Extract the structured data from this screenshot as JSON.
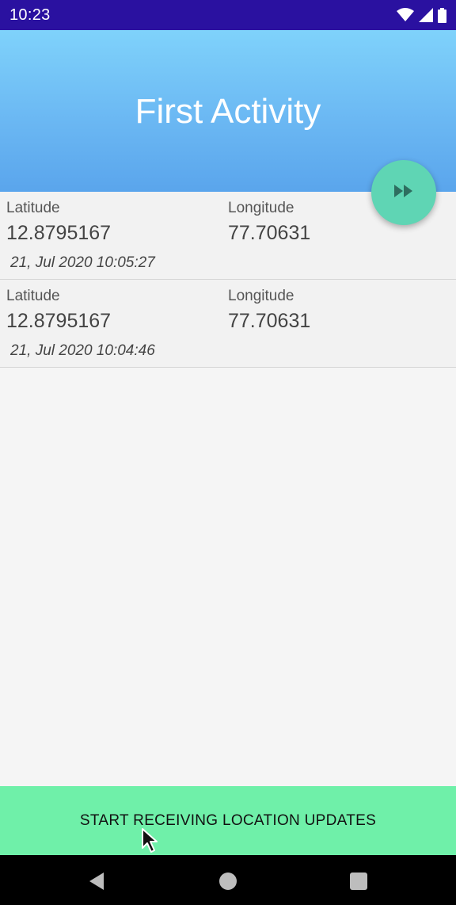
{
  "status_bar": {
    "time": "10:23",
    "icons": [
      "wifi-icon",
      "cellular-signal-icon",
      "battery-icon"
    ]
  },
  "header": {
    "title": "First Activity"
  },
  "fab": {
    "icon": "fast-forward-icon"
  },
  "locations": [
    {
      "latitude_label": "Latitude",
      "latitude": "12.8795167",
      "longitude_label": "Longitude",
      "longitude": "77.70631",
      "timestamp": "21, Jul 2020 10:05:27"
    },
    {
      "latitude_label": "Latitude",
      "latitude": "12.8795167",
      "longitude_label": "Longitude",
      "longitude": "77.70631",
      "timestamp": "21, Jul 2020 10:04:46"
    }
  ],
  "start_button": {
    "label": "START RECEIVING LOCATION UPDATES"
  },
  "nav_bar": {
    "buttons": [
      "back-icon",
      "home-icon",
      "recents-icon"
    ]
  },
  "colors": {
    "status_bar": "#2a11a0",
    "header_top": "#7fd2fb",
    "header_bottom": "#5aa5ec",
    "fab": "#5fd5b4",
    "start_button": "#6ff0a9"
  }
}
